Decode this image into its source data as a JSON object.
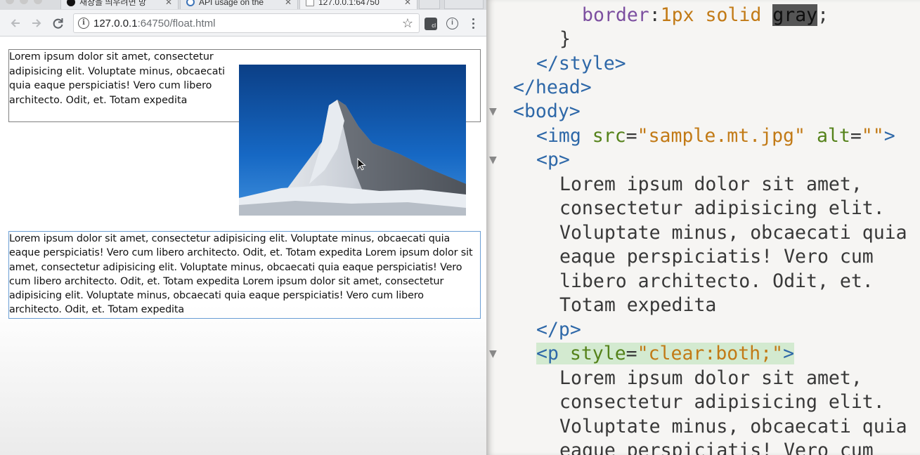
{
  "browser": {
    "tabs": [
      {
        "label": "새창을 띄우려면 방",
        "icon": "github-icon",
        "active": false
      },
      {
        "label": "API usage on the",
        "icon": "caniuse-icon",
        "active": false
      },
      {
        "label": "127.0.0.1:64750",
        "icon": "page-icon",
        "active": true
      }
    ],
    "toolbar": {
      "back_icon": "arrow-left-icon",
      "forward_icon": "arrow-right-icon",
      "reload_icon": "reload-icon",
      "url_host": "127.0.0.1",
      "url_rest": ":64750/float.html",
      "star_icon": "star-icon"
    },
    "page": {
      "paragraph1": "Lorem ipsum dolor sit amet, consectetur adipisicing elit. Voluptate minus, obcaecati quia eaque perspiciatis! Vero cum libero architecto. Odit, et. Totam expedita",
      "image_alt": "",
      "image_file": "sample.mt.jpg",
      "paragraph2": "Lorem ipsum dolor sit amet, consectetur adipisicing elit. Voluptate minus, obcaecati quia eaque perspiciatis! Vero cum libero architecto. Odit, et. Totam expedita Lorem ipsum dolor sit amet, consectetur adipisicing elit. Voluptate minus, obcaecati quia eaque perspiciatis! Vero cum libero architecto. Odit, et. Totam expedita Lorem ipsum dolor sit amet, consectetur adipisicing elit. Voluptate minus, obcaecati quia eaque perspiciatis! Vero cum libero architecto. Odit, et. Totam expedita"
    }
  },
  "editor": {
    "lines": {
      "l1_prop": "border",
      "l1_colon": ":",
      "l1_num": "1px",
      "l1_solid": "solid",
      "l1_sel": "gray",
      "l1_semi": ";",
      "l2": "}",
      "l3": "</style>",
      "l4": "</head>",
      "l5": "<body>",
      "l6_open": "<img",
      "l6_attr1": "src",
      "l6_eq": "=",
      "l6_val1": "\"sample.mt.jpg\"",
      "l6_attr2": "alt",
      "l6_val2": "\"\"",
      "l6_close": ">",
      "l7": "<p>",
      "l8": "Lorem ipsum dolor sit amet,",
      "l9": "consectetur adipisicing elit.",
      "l10": "Voluptate minus, obcaecati quia",
      "l11": "eaque perspiciatis! Vero cum",
      "l12": "libero architecto. Odit, et.",
      "l13": "Totam expedita",
      "l14": "</p>",
      "l15_open": "<p",
      "l15_attr": "style",
      "l15_eq": "=",
      "l15_val": "\"clear:both;\"",
      "l15_close": ">",
      "l16": "Lorem ipsum dolor sit amet,",
      "l17": "consectetur adipisicing elit.",
      "l18": "Voluptate minus, obcaecati quia",
      "l19": "eaque perspiciatis! Vero cum"
    },
    "fold_icon": "triangle-down-icon"
  },
  "colors": {
    "tag": "#2e68a8",
    "attr": "#55821a",
    "value": "#c27a16",
    "property": "#7c4fa0",
    "selection": "#555555",
    "highlight": "#d3ead0",
    "float_paragraph_border": "#808080",
    "clear_paragraph_border": "#6a9ed4"
  }
}
